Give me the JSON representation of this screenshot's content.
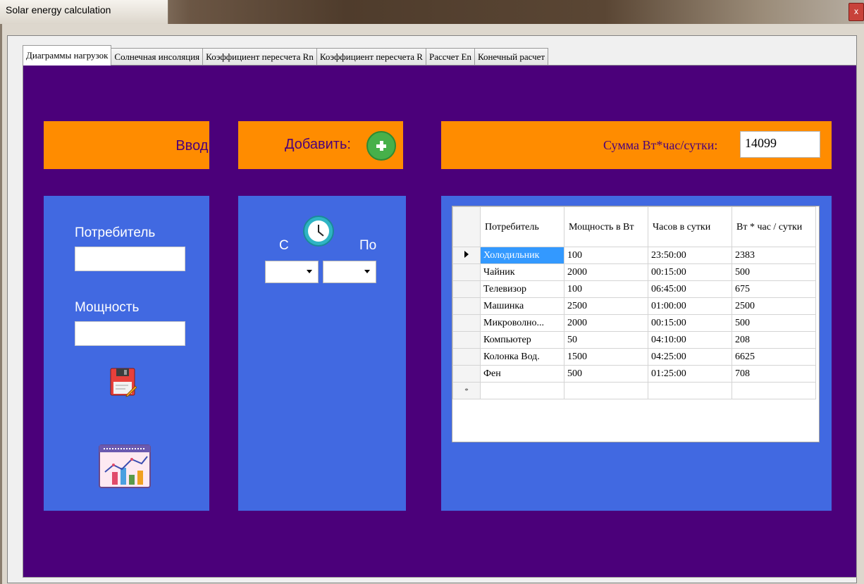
{
  "window": {
    "title": "Solar energy calculation",
    "close_glyph": "x"
  },
  "tabs": [
    {
      "label": "Диаграммы нагрузок",
      "active": true
    },
    {
      "label": "Солнечная инсоляция",
      "active": false
    },
    {
      "label": "Коэффициент пересчета Rn",
      "active": false
    },
    {
      "label": "Коэффициент пересчета R",
      "active": false
    },
    {
      "label": "Рассчет En",
      "active": false
    },
    {
      "label": "Конечный расчет",
      "active": false
    }
  ],
  "input_section": {
    "header": "Ввод:",
    "consumer_label": "Потребитель",
    "consumer_value": "",
    "power_label": "Мощность",
    "power_value": "",
    "save_icon": "floppy-disk-edit-icon",
    "chart_icon": "chart-report-icon"
  },
  "add_section": {
    "header": "Добавить:",
    "add_icon": "plus-circle-icon",
    "clock_icon": "clock-icon",
    "from_label": "С",
    "to_label": "По",
    "from_value": "",
    "to_value": ""
  },
  "summary": {
    "label": "Сумма Вт*час/сутки:",
    "value": "14099"
  },
  "grid": {
    "columns": [
      "Потребитель",
      "Мощность в Вт",
      "Часов в сутки",
      "Вт * час / сутки"
    ],
    "rows": [
      [
        "Холодильник",
        "100",
        "23:50:00",
        "2383"
      ],
      [
        "Чайник",
        "2000",
        "00:15:00",
        "500"
      ],
      [
        "Телевизор",
        "100",
        "06:45:00",
        "675"
      ],
      [
        "Машинка",
        "2500",
        "01:00:00",
        "2500"
      ],
      [
        "Микроволно...",
        "2000",
        "00:15:00",
        "500"
      ],
      [
        "Компьютер",
        "50",
        "04:10:00",
        "208"
      ],
      [
        "Колонка Вод.",
        "1500",
        "04:25:00",
        "6625"
      ],
      [
        "Фен",
        "500",
        "01:25:00",
        "708"
      ]
    ],
    "new_row_marker": "*"
  },
  "colors": {
    "panel_bg": "#4b007a",
    "header_bar": "#ff8c00",
    "card_bg": "#4169e1",
    "selection": "#3399ff"
  }
}
